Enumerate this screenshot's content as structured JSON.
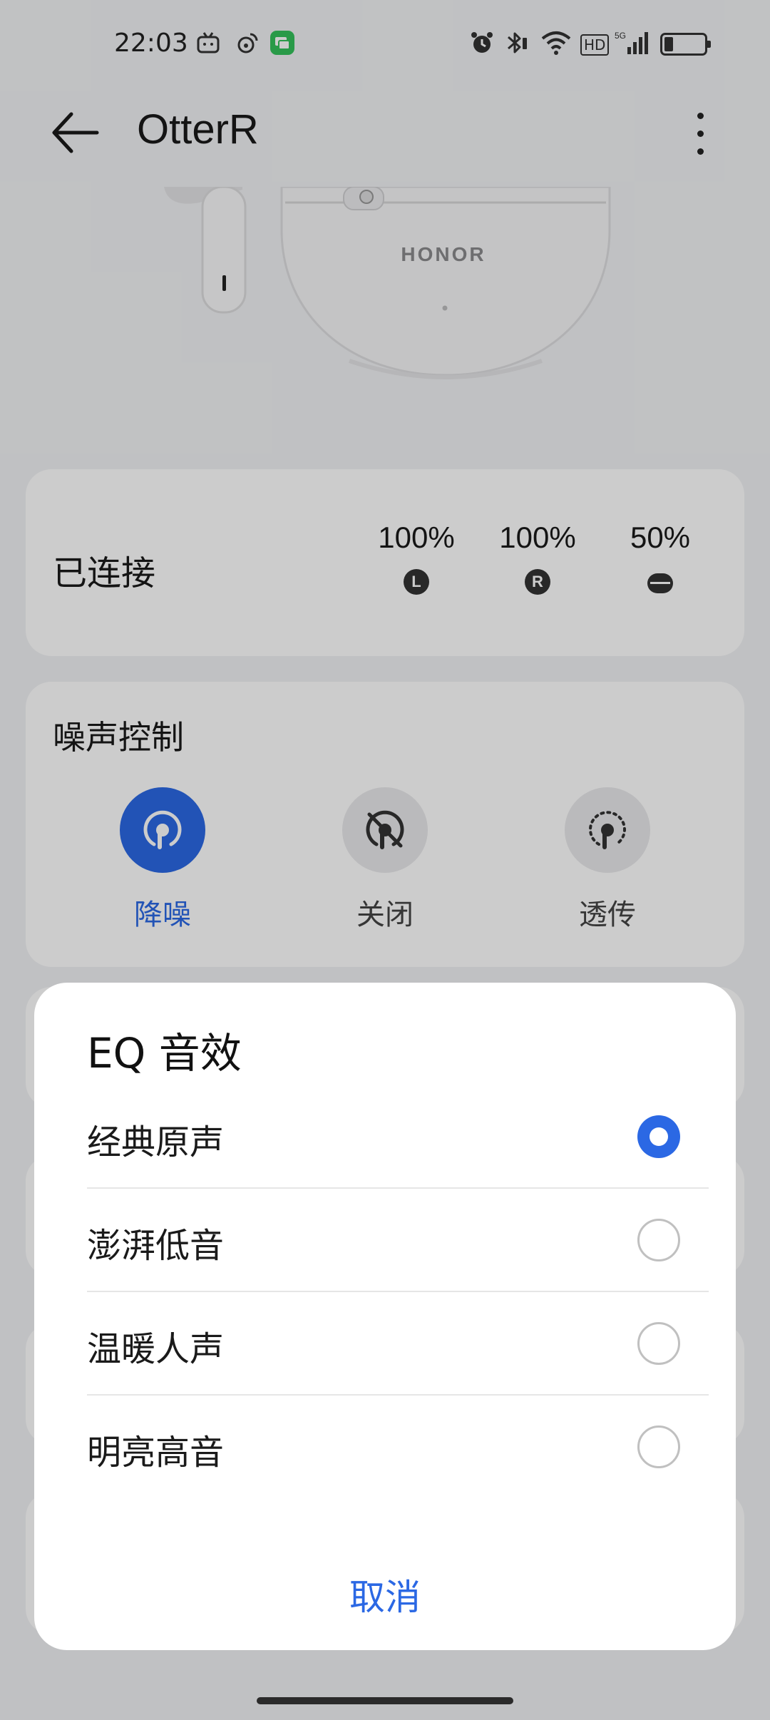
{
  "status_bar": {
    "time": "22:03",
    "hd_label": "HD",
    "network_label": "5G",
    "icons": [
      "tv-icon",
      "weibo-icon",
      "messages-icon",
      "alarm-icon",
      "bluetooth-icon",
      "wifi-icon",
      "signal-icon",
      "battery-icon"
    ]
  },
  "app_bar": {
    "title": "OtterR"
  },
  "hero": {
    "brand": "HONOR"
  },
  "connection": {
    "status": "已连接",
    "left": {
      "percent": "100%",
      "badge": "L"
    },
    "right": {
      "percent": "100%",
      "badge": "R"
    },
    "case": {
      "percent": "50%"
    }
  },
  "noise_control": {
    "title": "噪声控制",
    "modes": [
      {
        "label": "降噪",
        "active": true
      },
      {
        "label": "关闭",
        "active": false
      },
      {
        "label": "透传",
        "active": false
      }
    ]
  },
  "eq_dialog": {
    "title": "EQ 音效",
    "options": [
      {
        "label": "经典原声",
        "selected": true
      },
      {
        "label": "澎湃低音",
        "selected": false
      },
      {
        "label": "温暖人声",
        "selected": false
      },
      {
        "label": "明亮高音",
        "selected": false
      }
    ],
    "cancel_label": "取消"
  },
  "colors": {
    "accent": "#2b68e4",
    "background": "#f1f2f4",
    "card": "#ffffff"
  }
}
